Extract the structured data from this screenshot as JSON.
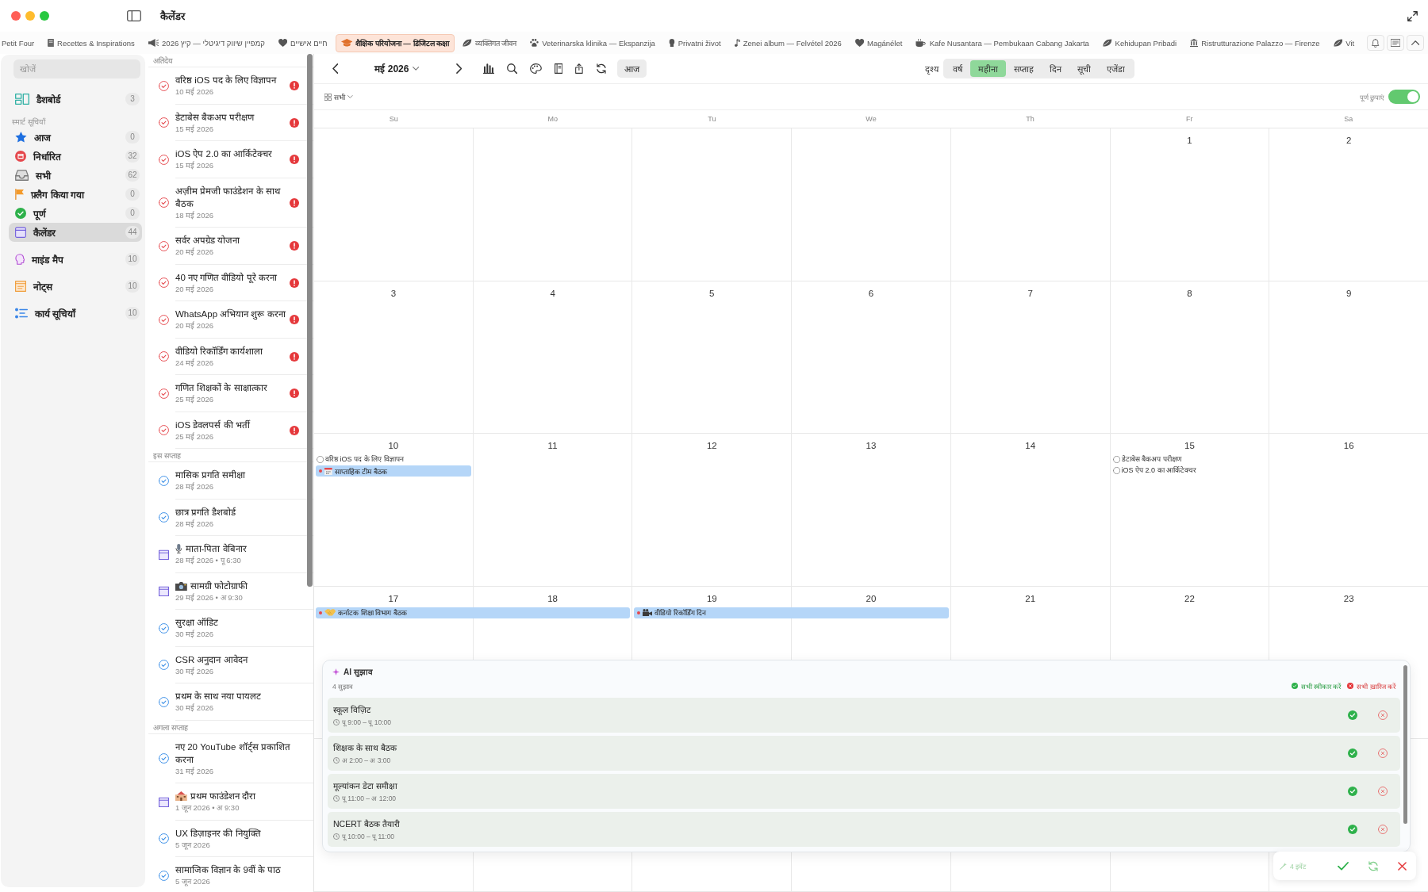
{
  "window": {
    "title": "कैलेंडर"
  },
  "tabs": [
    {
      "label": "Petit Four",
      "selected": false
    },
    {
      "label": "Recettes & Inspirations",
      "selected": false
    },
    {
      "label": "קמפיין שיווק דיגיטלי — קיץ 2026",
      "selected": false
    },
    {
      "label": "חיים אישיים",
      "selected": false
    },
    {
      "label": "शैक्षिक परियोजना — डिजिटल कक्षा",
      "selected": true
    },
    {
      "label": "व्यक्तिगत जीवन",
      "selected": false
    },
    {
      "label": "Veterinarska klinika — Ekspanzija",
      "selected": false
    },
    {
      "label": "Privatni život",
      "selected": false
    },
    {
      "label": "Zenei album — Felvétel 2026",
      "selected": false
    },
    {
      "label": "Magánélet",
      "selected": false
    },
    {
      "label": "Kafe Nusantara — Pembukaan Cabang Jakarta",
      "selected": false
    },
    {
      "label": "Kehidupan Pribadi",
      "selected": false
    },
    {
      "label": "Ristrutturazione Palazzo — Firenze",
      "selected": false
    },
    {
      "label": "Vit",
      "selected": false
    }
  ],
  "sidebar": {
    "search": {
      "placeholder": "खोजें"
    },
    "groups": [
      {
        "items": [
          {
            "label": "डैशबोर्ड",
            "count": "3",
            "selected": false
          }
        ]
      },
      {
        "title": "स्मार्ट सूचियाँ",
        "items": [
          {
            "label": "आज",
            "count": "0",
            "selected": false
          },
          {
            "label": "निर्धारित",
            "count": "32",
            "selected": false
          },
          {
            "label": "सभी",
            "count": "62",
            "selected": false
          },
          {
            "label": "फ़्लैग किया गया",
            "count": "0",
            "selected": false
          },
          {
            "label": "पूर्ण",
            "count": "0",
            "selected": false
          },
          {
            "label": "कैलेंडर",
            "count": "44",
            "selected": true
          }
        ]
      },
      {
        "items": [
          {
            "label": "माइंड मैप",
            "count": "10",
            "selected": false
          },
          {
            "label": "नोट्स",
            "count": "10",
            "selected": false
          },
          {
            "label": "कार्य सूचियाँ",
            "count": "10",
            "selected": false
          }
        ]
      }
    ]
  },
  "task_list": {
    "sections": [
      {
        "title": "अतिदेय",
        "items": [
          {
            "kind": "task",
            "overdue": true,
            "title": "वरिष्ठ iOS पद के लिए विज्ञापन",
            "date": "10 मई 2026"
          },
          {
            "kind": "task",
            "overdue": true,
            "title": "डेटाबेस बैकअप परीक्षण",
            "date": "15 मई 2026"
          },
          {
            "kind": "task",
            "overdue": true,
            "title": "iOS ऐप 2.0 का आर्किटेक्चर",
            "date": "15 मई 2026"
          },
          {
            "kind": "task",
            "overdue": true,
            "title": "अज़ीम प्रेमजी फाउंडेशन के साथ बैठक",
            "date": "18 मई 2026"
          },
          {
            "kind": "task",
            "overdue": true,
            "title": "सर्वर अपग्रेड योजना",
            "date": "20 मई 2026"
          },
          {
            "kind": "task",
            "overdue": true,
            "title": "40 नए गणित वीडियो पूरे करना",
            "date": "20 मई 2026"
          },
          {
            "kind": "task",
            "overdue": true,
            "title": "WhatsApp अभियान शुरू करना",
            "date": "20 मई 2026"
          },
          {
            "kind": "task",
            "overdue": true,
            "title": "वीडियो रिकॉर्डिंग कार्यशाला",
            "date": "24 मई 2026"
          },
          {
            "kind": "task",
            "overdue": true,
            "title": "गणित शिक्षकों के साक्षात्कार",
            "date": "25 मई 2026"
          },
          {
            "kind": "task",
            "overdue": true,
            "title": "iOS डेवलपर्स की भर्ती",
            "date": "25 मई 2026"
          }
        ]
      },
      {
        "title": "इस सप्ताह",
        "items": [
          {
            "kind": "task",
            "overdue": false,
            "title": "मासिक प्रगति समीक्षा",
            "date": "28 मई 2026"
          },
          {
            "kind": "task",
            "overdue": false,
            "title": "छात्र प्रगति डैशबोर्ड",
            "date": "28 मई 2026"
          },
          {
            "kind": "event",
            "title": "माता-पिता वेबिनार",
            "date": "28 मई 2026 • पू 6:30"
          },
          {
            "kind": "event",
            "title": "सामग्री फोटोग्राफी",
            "date": "29 मई 2026 • अ 9:30"
          },
          {
            "kind": "task",
            "overdue": false,
            "title": "सुरक्षा ऑडिट",
            "date": "30 मई 2026"
          },
          {
            "kind": "task",
            "overdue": false,
            "title": "CSR अनुदान आवेदन",
            "date": "30 मई 2026"
          },
          {
            "kind": "task",
            "overdue": false,
            "title": "प्रथम के साथ नया पायलट",
            "date": "30 मई 2026"
          }
        ]
      },
      {
        "title": "अगला सप्ताह",
        "items": [
          {
            "kind": "task",
            "overdue": false,
            "title": "नए 20 YouTube शॉर्ट्स प्रकाशित करना",
            "date": "31 मई 2026"
          },
          {
            "kind": "event",
            "title": "प्रथम फाउंडेशन दौरा",
            "date": "1 जून 2026 • अ 9:30"
          },
          {
            "kind": "task",
            "overdue": false,
            "title": "UX डिज़ाइनर की नियुक्ति",
            "date": "5 जून 2026"
          },
          {
            "kind": "task",
            "overdue": false,
            "title": "सामाजिक विज्ञान के 9वीं के पाठ",
            "date": "5 जून 2026"
          }
        ]
      }
    ]
  },
  "calendar": {
    "month": "मई 2026",
    "today_button": "आज",
    "view_label": "दृश्य",
    "views": [
      {
        "label": "वर्ष",
        "selected": false
      },
      {
        "label": "महीना",
        "selected": true
      },
      {
        "label": "सप्ताह",
        "selected": false
      },
      {
        "label": "दिन",
        "selected": false
      },
      {
        "label": "सूची",
        "selected": false
      },
      {
        "label": "एजेंडा",
        "selected": false
      }
    ],
    "filter": "सभी",
    "hide_completed": {
      "label": "पूर्ण छुपाएं",
      "on": true
    },
    "weekdays": [
      "Su",
      "Mo",
      "Tu",
      "We",
      "Th",
      "Fr",
      "Sa"
    ],
    "weeks": [
      {
        "days": [
          {
            "date": "1"
          },
          {
            "date": "2"
          }
        ]
      },
      {
        "days": [
          {
            "date": "3"
          },
          {
            "date": "4"
          },
          {
            "date": "5"
          },
          {
            "date": "6"
          },
          {
            "date": "7"
          },
          {
            "date": "8"
          },
          {
            "date": "9"
          }
        ]
      },
      {
        "days": [
          {
            "date": "10",
            "events": [
              {
                "kind": "task",
                "title": "वरिष्ठ iOS पद के लिए विज्ञापन",
                "done": false
              },
              {
                "kind": "event",
                "title": "साप्ताहिक टीम बैठक",
                "continues_next_day": false
              }
            ]
          },
          {
            "date": "11"
          },
          {
            "date": "12"
          },
          {
            "date": "13"
          },
          {
            "date": "14"
          },
          {
            "date": "15",
            "events": [
              {
                "kind": "task",
                "title": "डेटाबेस बैकअप परीक्षण",
                "done": false
              },
              {
                "kind": "task",
                "title": "iOS ऐप 2.0 का आर्किटेक्चर",
                "done": false
              }
            ]
          },
          {
            "date": "16"
          }
        ]
      },
      {
        "days": [
          {
            "date": "17",
            "events": [
              {
                "kind": "event",
                "title": "कर्नाटक शिक्षा विभाग बैठक",
                "continues_next_day": true
              }
            ]
          },
          {
            "date": "18"
          },
          {
            "date": "19",
            "events": [
              {
                "kind": "event",
                "title": "वीडियो रिकॉर्डिंग दिन",
                "continues_next_day": true
              }
            ]
          },
          {
            "date": "20"
          },
          {
            "date": "21"
          },
          {
            "date": "22"
          },
          {
            "date": "23"
          }
        ]
      }
    ]
  },
  "ai_suggestions": {
    "title": "AI सुझाव",
    "count": "4 सुझाव",
    "accept_all": "सभी स्वीकार करें",
    "reject_all": "सभी ख़ारिज करें",
    "items": [
      {
        "title": "स्कूल विज़िट",
        "time": "पू 9:00 – पू 10:00"
      },
      {
        "title": "शिक्षक के साथ बैठक",
        "time": "अ 2:00 – अ 3:00"
      },
      {
        "title": "मूल्यांकन डेटा समीक्षा",
        "time": "पू 11:00 – अ 12:00"
      },
      {
        "title": "NCERT बैठक तैयारी",
        "time": "पू 10:00 – पू 11:00"
      }
    ]
  },
  "floating_toolbar": {
    "label": "4 इवेंट"
  }
}
